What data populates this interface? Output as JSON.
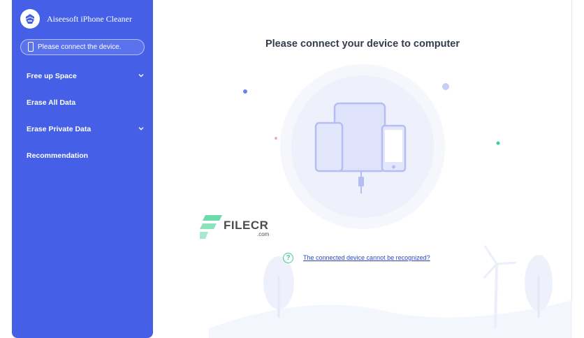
{
  "app": {
    "title": "Aiseesoft iPhone Cleaner"
  },
  "sidebar": {
    "device_status": "Please connect the device.",
    "items": [
      {
        "label": "Free up Space",
        "has_chevron": true
      },
      {
        "label": "Erase All Data",
        "has_chevron": false
      },
      {
        "label": "Erase Private Data",
        "has_chevron": true
      },
      {
        "label": "Recommendation",
        "has_chevron": false
      }
    ]
  },
  "main": {
    "heading": "Please connect your device to computer",
    "help_link": "The connected device cannot be recognized?"
  },
  "watermark": {
    "text": "FILECR",
    "suffix": ".com"
  },
  "colors": {
    "sidebar": "#4560e6",
    "accent_green": "#3ecf8e",
    "link": "#2c46c9",
    "illustration": "#b6bdf3"
  },
  "icons": [
    "app-logo-icon",
    "phone-icon",
    "chevron-down-icon",
    "help-icon",
    "devices-illustration"
  ]
}
